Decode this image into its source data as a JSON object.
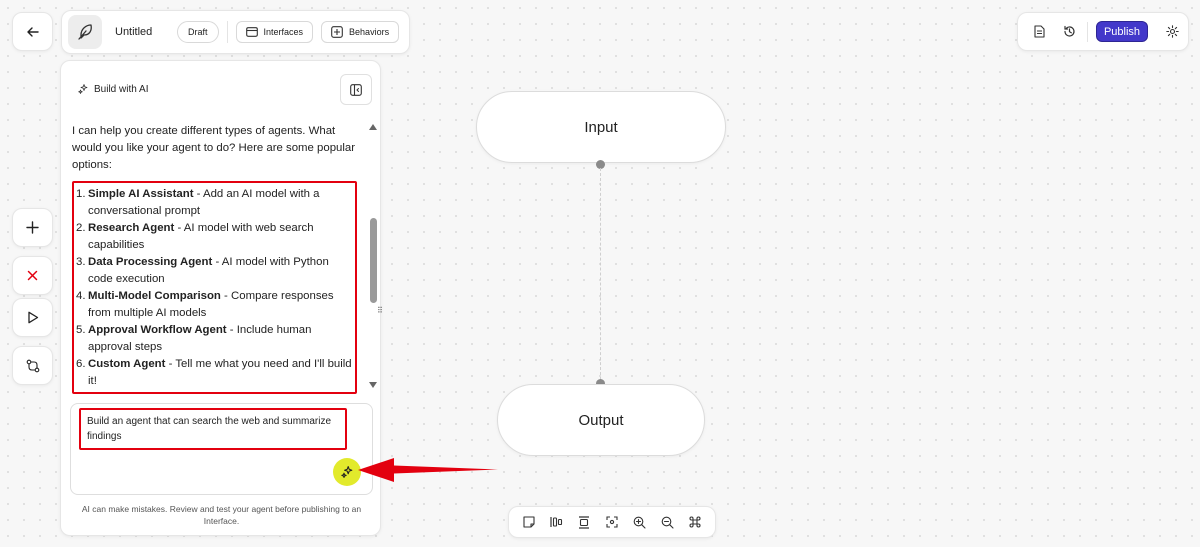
{
  "header": {
    "back_icon": "arrow-left-icon",
    "logo_icon": "feather-icon",
    "title": "Untitled",
    "status_badge": "Draft",
    "tabs": [
      {
        "label": "Interfaces",
        "icon": "window-icon"
      },
      {
        "label": "Behaviors",
        "icon": "sparkle-box-icon"
      }
    ],
    "right": {
      "document_icon": "document-icon",
      "history_icon": "history-icon",
      "publish_label": "Publish",
      "settings_icon": "gear-icon",
      "publish_color": "#4338ca"
    }
  },
  "sidebar": {
    "buttons": [
      {
        "name": "add",
        "icon": "plus-icon"
      },
      {
        "name": "delete",
        "icon": "x-icon",
        "color": "#e3000f"
      },
      {
        "name": "run",
        "icon": "play-icon"
      },
      {
        "name": "version",
        "icon": "git-compare-icon"
      }
    ]
  },
  "ai_panel": {
    "title": "Build with AI",
    "title_icon": "sparkles-icon",
    "collapse_icon": "panel-left-icon",
    "intro": "I can help you create different types of agents. What would you like your agent to do? Here are some popular options:",
    "options": [
      {
        "num": "1.",
        "name": "Simple AI Assistant",
        "desc": " - Add an AI model with a conversational prompt"
      },
      {
        "num": "2.",
        "name": "Research Agent",
        "desc": " - AI model with web search capabilities"
      },
      {
        "num": "3.",
        "name": "Data Processing Agent",
        "desc": " - AI model with Python code execution"
      },
      {
        "num": "4.",
        "name": "Multi-Model Comparison",
        "desc": " - Compare responses from multiple AI models"
      },
      {
        "num": "5.",
        "name": "Approval Workflow Agent",
        "desc": " - Include human approval steps"
      },
      {
        "num": "6.",
        "name": "Custom Agent",
        "desc": " - Tell me what you need and I'll build it!"
      }
    ],
    "input_value": "Build an agent that can search the web and summarize findings",
    "send_icon": "sparkles-icon",
    "send_color": "#e2ea2c",
    "disclaimer": "AI can make mistakes. Review and test your agent before publishing to an Interface."
  },
  "canvas": {
    "nodes": [
      {
        "id": "input",
        "label": "Input"
      },
      {
        "id": "output",
        "label": "Output"
      }
    ]
  },
  "toolbar": [
    {
      "name": "note",
      "icon": "sticky-note-icon"
    },
    {
      "name": "align-horizontal",
      "icon": "align-horizontal-icon"
    },
    {
      "name": "align-vertical",
      "icon": "align-vertical-icon"
    },
    {
      "name": "fit-view",
      "icon": "focus-icon"
    },
    {
      "name": "zoom-in",
      "icon": "zoom-in-icon"
    },
    {
      "name": "zoom-out",
      "icon": "zoom-out-icon"
    },
    {
      "name": "shortcuts",
      "icon": "command-icon"
    }
  ],
  "annotation_color": "#e3000f"
}
